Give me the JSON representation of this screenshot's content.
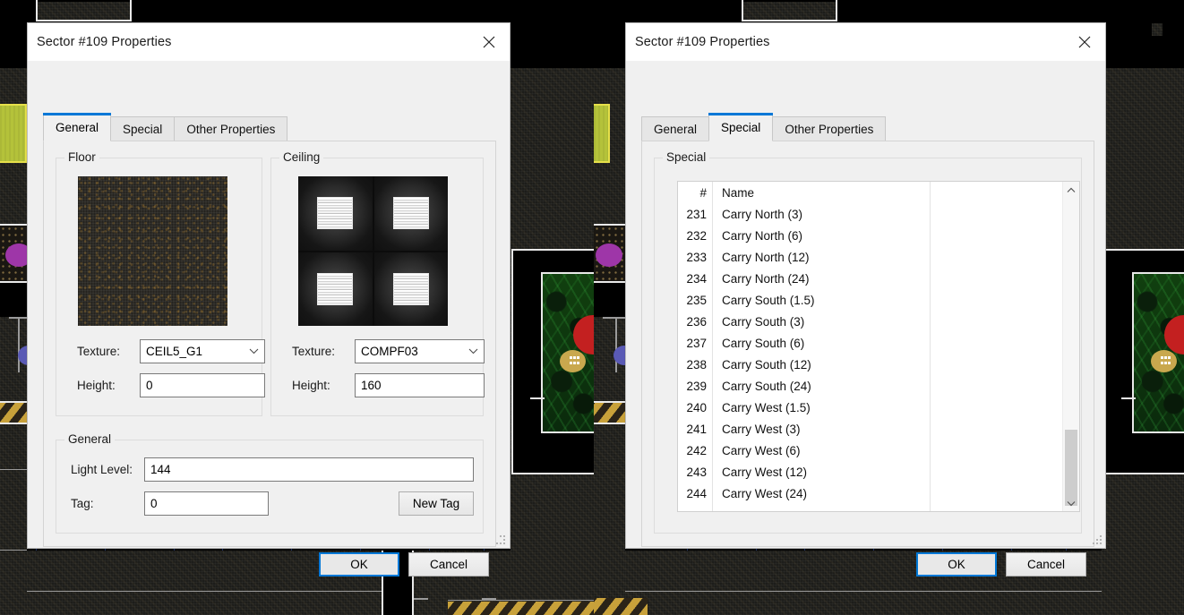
{
  "app": {
    "name": "doom-map-editor",
    "accent_color": "#0078d7",
    "dialog_bg": "#f0f0f0",
    "titlebar_bg": "#ffffff"
  },
  "dialogs": [
    {
      "id": "left",
      "title": "Sector #109 Properties",
      "close_label": "✕",
      "active_tab": "General",
      "tabs": [
        {
          "label": "General"
        },
        {
          "label": "Special"
        },
        {
          "label": "Other Properties"
        }
      ],
      "groups": {
        "floor": {
          "legend": "Floor",
          "texture_label": "Texture:",
          "texture_value": "CEIL5_G1",
          "height_label": "Height:",
          "height_value": "0",
          "preview_icon": "floor-texture-preview"
        },
        "ceiling": {
          "legend": "Ceiling",
          "texture_label": "Texture:",
          "texture_value": "COMPF03",
          "height_label": "Height:",
          "height_value": "160",
          "preview_icon": "ceiling-texture-preview"
        },
        "general": {
          "legend": "General",
          "light_label": "Light Level:",
          "light_value": "144",
          "tag_label": "Tag:",
          "tag_value": "0",
          "new_tag_label": "New Tag"
        }
      },
      "buttons": {
        "ok": "OK",
        "cancel": "Cancel"
      }
    },
    {
      "id": "right",
      "title": "Sector #109 Properties",
      "close_label": "✕",
      "active_tab": "Special",
      "tabs": [
        {
          "label": "General"
        },
        {
          "label": "Special"
        },
        {
          "label": "Other Properties"
        }
      ],
      "special": {
        "legend": "Special",
        "columns": [
          "#",
          "Name"
        ],
        "rows": [
          {
            "num": "231",
            "name": "Carry North (3)"
          },
          {
            "num": "232",
            "name": "Carry North (6)"
          },
          {
            "num": "233",
            "name": "Carry North (12)"
          },
          {
            "num": "234",
            "name": "Carry North (24)"
          },
          {
            "num": "235",
            "name": "Carry South (1.5)"
          },
          {
            "num": "236",
            "name": "Carry South (3)"
          },
          {
            "num": "237",
            "name": "Carry South (6)"
          },
          {
            "num": "238",
            "name": "Carry South (12)"
          },
          {
            "num": "239",
            "name": "Carry South (24)"
          },
          {
            "num": "240",
            "name": "Carry West (1.5)"
          },
          {
            "num": "241",
            "name": "Carry West (3)"
          },
          {
            "num": "242",
            "name": "Carry West (6)"
          },
          {
            "num": "243",
            "name": "Carry West (12)"
          },
          {
            "num": "244",
            "name": "Carry West (24)"
          }
        ],
        "scroll_up_icon": "chevron-up-icon",
        "scroll_down_icon": "chevron-down-icon"
      },
      "buttons": {
        "ok": "OK",
        "cancel": "Cancel"
      }
    }
  ]
}
